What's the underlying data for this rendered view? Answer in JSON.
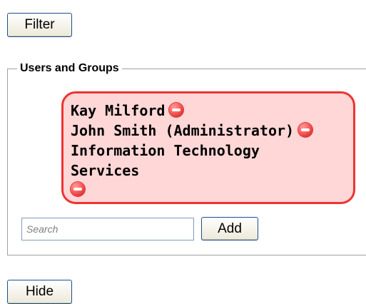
{
  "toolbar": {
    "filter_label": "Filter",
    "hide_label": "Hide"
  },
  "users_and_groups": {
    "legend": "Users and Groups",
    "selected": [
      {
        "name": "Kay Milford",
        "icon": "remove-icon"
      },
      {
        "name": "John Smith (Administrator)",
        "icon": "remove-icon"
      },
      {
        "name": "Information Technology Services",
        "icon": "remove-icon"
      }
    ],
    "search": {
      "value": "",
      "placeholder": "Search"
    },
    "add_label": "Add"
  },
  "colors": {
    "selected_background": "#ffd7d7",
    "selected_border": "#ee3333",
    "remove_icon": "#e23b3b"
  }
}
